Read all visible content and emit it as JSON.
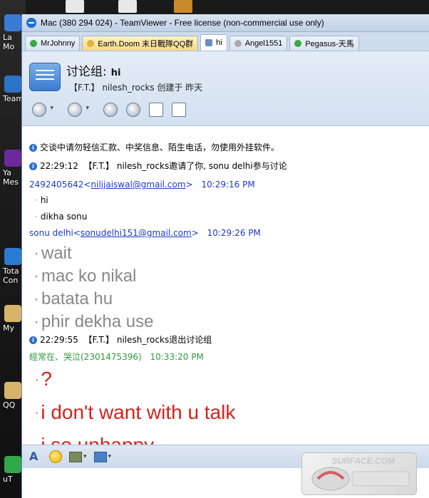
{
  "desktop": {
    "icons": [
      {
        "label": "La\nMo",
        "color": "#3b7bd1"
      },
      {
        "label": "Team",
        "color": "#2a73c6"
      },
      {
        "label": "Ya\nMes",
        "color": "#6a2a9c"
      },
      {
        "label": "Tota\nCon",
        "color": "#2b7bd2"
      },
      {
        "label": "My",
        "color": "#d8b46a"
      },
      {
        "label": "QQ",
        "color": "#d8b46a"
      },
      {
        "label": "uT",
        "color": "#2fa84a"
      }
    ]
  },
  "window": {
    "title": "Mac (380 294 024) - TeamViewer - Free license (non-commercial use only)"
  },
  "tabs": [
    {
      "label": "MrJohnny",
      "status": "green"
    },
    {
      "label": "Earth.Doom 末日戰隊QQ群",
      "status": "yellow"
    },
    {
      "label": "hi",
      "status": "chat"
    },
    {
      "label": "Angel1551",
      "status": "grey"
    },
    {
      "label": "Pegasus-天馬",
      "status": "green"
    }
  ],
  "group": {
    "title": "讨论组:",
    "name": "hi",
    "subtitle": "【F.T.】 nilesh_rocks 创建于 昨天"
  },
  "chat": {
    "notice": "交谈中请勿轻信汇款、中奖信息、陌生电话，勿使用外挂软件。",
    "system1": {
      "time": "22:29:12",
      "text": "【F.T.】 nilesh_rocks邀请了你, sonu delhi参与讨论"
    },
    "sender1": {
      "name": "2492405642<",
      "email": "niljjaiswal@gmail.com",
      "close": ">",
      "time": "10:29:16 PM"
    },
    "messages1": [
      "hi",
      "dikha sonu"
    ],
    "sender2": {
      "name": "sonu delhi<",
      "email": "sonudelhi151@gmail.com",
      "close": ">",
      "time": "10:29:26 PM"
    },
    "messages2": [
      "wait",
      "mac ko nikal",
      "batata hu",
      "phir dekha use"
    ],
    "system2": {
      "time": "22:29:55",
      "text": "【F.T.】 nilesh_rocks退出讨论组"
    },
    "sender3": {
      "name": "經常在、哭泣(2301475396)",
      "time": "10:33:20 PM"
    },
    "messages3": [
      "?",
      "i don't want with u talk",
      "i so unhappy"
    ]
  },
  "watermark": {
    "text": "SURFACE.COM"
  }
}
